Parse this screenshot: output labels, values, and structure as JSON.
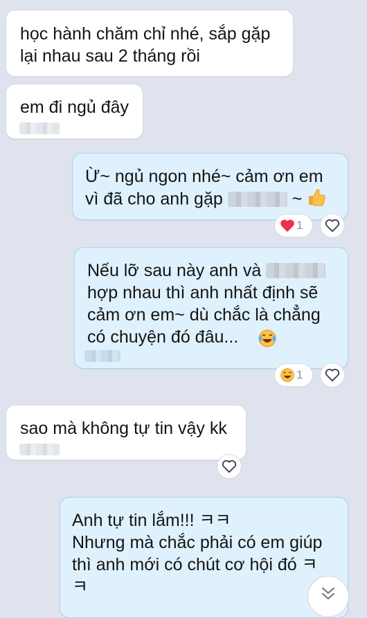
{
  "messages": [
    {
      "text": "học hành chăm chỉ nhé, sắp gặp\nlại nhau sau 2 tháng rồi"
    },
    {
      "text": "em đi ngủ đây"
    },
    {
      "line1_prefix": "Ừ~ ngủ ngon nhé~ cảm ơn em",
      "line2_prefix": "vì đã cho anh gặp",
      "line2_suffix": "~",
      "reaction_count": "1"
    },
    {
      "line1_prefix": "Nếu lỡ sau này anh và",
      "rest": "hợp nhau thì anh nhất định sẽ\ncảm ơn em~ dù chắc là chẳng\ncó chuyện đó đâu...",
      "reaction_count": "1"
    },
    {
      "text": "sao mà không tự tin vậy kk"
    },
    {
      "text": "Anh tự tin lắm!!! ㅋㅋ\nNhưng mà chắc phải có em giúp\nthì anh mới có chút cơ hội đó ㅋ\nㅋ"
    }
  ],
  "colors": {
    "background": "#dfe3ed",
    "incoming_bubble": "#ffffff",
    "outgoing_bubble": "#dff1fd",
    "outgoing_border": "#a9d3ef"
  },
  "icons": [
    "heart-icon",
    "thumbs-up-emoji",
    "laughing-emoji",
    "chevron-double-down-icon"
  ]
}
